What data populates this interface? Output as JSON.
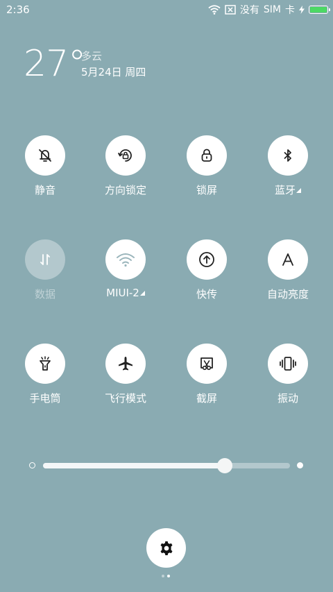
{
  "status": {
    "time": "2:36",
    "carrier_a": "没有",
    "carrier_b": "SIM",
    "carrier_c": "卡",
    "battery_level": 1.0,
    "battery_color": "#4cd964"
  },
  "weather": {
    "temperature": "27°",
    "condition": "多云",
    "date": "5月24日 周四"
  },
  "toggles": [
    {
      "label": "静音",
      "icon": "bell-off-icon",
      "state": "on"
    },
    {
      "label": "方向锁定",
      "icon": "rotation-lock-icon",
      "state": "on"
    },
    {
      "label": "锁屏",
      "icon": "lock-icon",
      "state": "on"
    },
    {
      "label": "蓝牙",
      "icon": "bluetooth-icon",
      "state": "on",
      "has_menu": true
    },
    {
      "label": "数据",
      "icon": "mobile-data-icon",
      "state": "off"
    },
    {
      "label": "MIUI-2",
      "icon": "wifi-icon",
      "state": "on",
      "has_menu": true
    },
    {
      "label": "快传",
      "icon": "upload-circle-icon",
      "state": "on"
    },
    {
      "label": "自动亮度",
      "icon": "auto-brightness-icon",
      "state": "on"
    },
    {
      "label": "手电筒",
      "icon": "flashlight-icon",
      "state": "on"
    },
    {
      "label": "飞行模式",
      "icon": "airplane-icon",
      "state": "on"
    },
    {
      "label": "截屏",
      "icon": "screenshot-icon",
      "state": "on"
    },
    {
      "label": "振动",
      "icon": "vibrate-icon",
      "state": "on"
    }
  ],
  "brightness": {
    "level": 0.736
  },
  "pager": {
    "count": 2,
    "active": 1
  },
  "colors": {
    "background": "#8aabb2",
    "icon": "#222222",
    "dim_icon": "#ffffff"
  }
}
